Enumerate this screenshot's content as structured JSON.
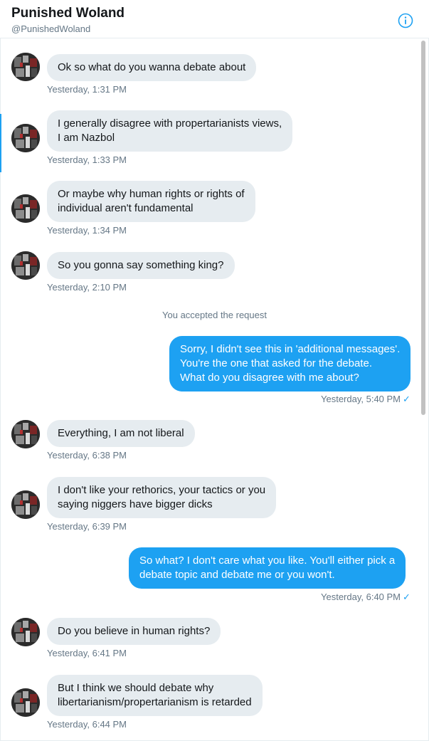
{
  "header": {
    "name": "Punished Woland",
    "handle": "@PunishedWoland",
    "info_icon": "info-icon"
  },
  "messages": [
    {
      "direction": "incoming",
      "lines": [
        "Ok so what do you wanna debate about"
      ],
      "timestamp": "Yesterday, 1:31 PM"
    },
    {
      "direction": "incoming",
      "lines": [
        "I generally disagree with propertarianists views,",
        "I am Nazbol"
      ],
      "timestamp": "Yesterday, 1:33 PM"
    },
    {
      "direction": "incoming",
      "lines": [
        "Or maybe why human rights or rights of",
        "individual aren't fundamental"
      ],
      "timestamp": "Yesterday, 1:34 PM"
    },
    {
      "direction": "incoming",
      "lines": [
        "So you gonna say something king?"
      ],
      "timestamp": "Yesterday, 2:10 PM"
    },
    {
      "direction": "outgoing",
      "lines": [
        "Sorry, I didn't see this in 'additional messages'.",
        "You're the one that asked for the debate.",
        "What do you disagree with me about?"
      ],
      "timestamp": "Yesterday, 5:40 PM",
      "read_mark": "✓"
    },
    {
      "direction": "incoming",
      "lines": [
        "Everything, I am not liberal"
      ],
      "timestamp": "Yesterday, 6:38 PM"
    },
    {
      "direction": "incoming",
      "lines": [
        "I don't like your rethorics, your tactics or you",
        "saying niggers have bigger dicks"
      ],
      "timestamp": "Yesterday, 6:39 PM"
    },
    {
      "direction": "outgoing",
      "lines": [
        "So what? I don't care what you like. You'll either  pick a",
        "debate topic and debate me or you won't."
      ],
      "timestamp": "Yesterday, 6:40 PM",
      "read_mark": "✓"
    },
    {
      "direction": "incoming",
      "lines": [
        "Do you believe in human rights?"
      ],
      "timestamp": "Yesterday, 6:41 PM"
    },
    {
      "direction": "incoming",
      "lines": [
        "But I think we should debate why",
        "libertarianism/propertarianism is retarded"
      ],
      "timestamp": "Yesterday, 6:44 PM"
    }
  ],
  "system_notice": "You accepted the request",
  "colors": {
    "accent": "#1da1f2",
    "incoming_bubble": "#e6ecf0",
    "secondary_text": "#657786"
  }
}
